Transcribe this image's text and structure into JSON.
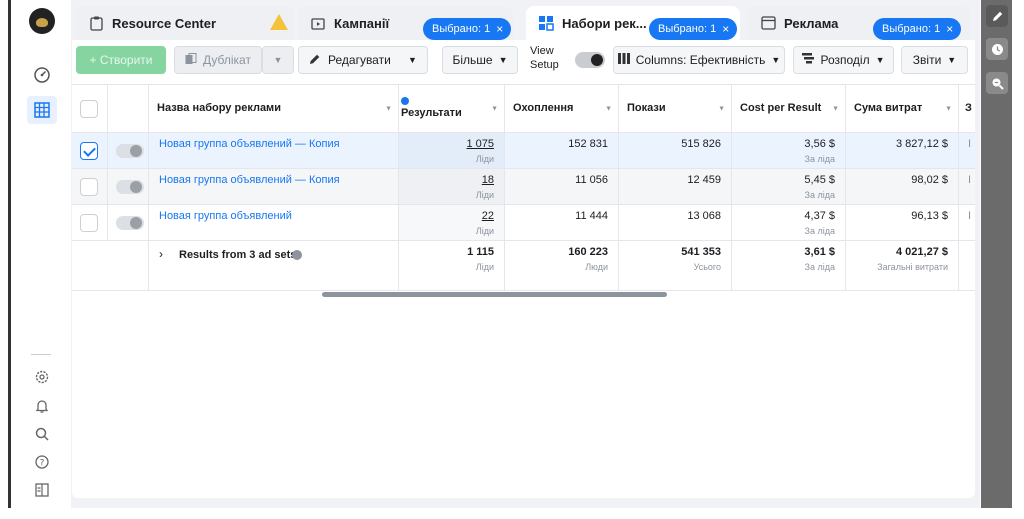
{
  "tabs": {
    "resource": {
      "label": "Resource Center"
    },
    "campaigns": {
      "label": "Кампанії"
    },
    "adsets": {
      "label": "Набори рек...",
      "chip": "Выбрано: 1"
    },
    "ads": {
      "label": "Реклама",
      "chip": "Выбрано: 1"
    },
    "campaigns_chip": "Выбрано: 1"
  },
  "toolbar": {
    "create": "+ Створити",
    "duplicate": "Дублікат",
    "edit": "Редагувати",
    "more": "Більше",
    "view_setup": "View Setup",
    "columns": "Columns: Ефективність",
    "breakdown": "Розподіл",
    "reports": "Звіти"
  },
  "table": {
    "headers": {
      "name": "Назва набору реклами",
      "results": "Результати",
      "reach": "Охоплення",
      "impressions": "Покази",
      "cpr": "Cost per Result",
      "spend": "Сума витрат",
      "extra": "З"
    },
    "rows": [
      {
        "name": "Новая группа объявлений — Копия",
        "results": "1 075",
        "results_sub": "Ліди",
        "reach": "152 831",
        "impressions": "515 826",
        "cpr": "3,56 $",
        "cpr_sub": "За ліда",
        "spend": "3 827,12 $",
        "extra": "I",
        "checked": true
      },
      {
        "name": "Новая группа объявлений — Копия",
        "results": "18",
        "results_sub": "Ліди",
        "reach": "11 056",
        "impressions": "12 459",
        "cpr": "5,45 $",
        "cpr_sub": "За ліда",
        "spend": "98,02 $",
        "extra": "I",
        "checked": false
      },
      {
        "name": "Новая группа объявлений",
        "results": "22",
        "results_sub": "Ліди",
        "reach": "11 444",
        "impressions": "13 068",
        "cpr": "4,37 $",
        "cpr_sub": "За ліда",
        "spend": "96,13 $",
        "extra": "I",
        "checked": false
      }
    ],
    "totals": {
      "label": "Results from 3 ad sets",
      "results": "1 115",
      "results_sub": "Ліди",
      "reach": "160 223",
      "reach_sub": "Люди",
      "impressions": "541 353",
      "impressions_sub": "Усього",
      "cpr": "3,61 $",
      "cpr_sub": "За ліда",
      "spend": "4 021,27 $",
      "spend_sub": "Загальні витрати"
    }
  },
  "colors": {
    "accent": "#1877f2",
    "create": "#86d49f",
    "warning": "#f5c33b"
  }
}
